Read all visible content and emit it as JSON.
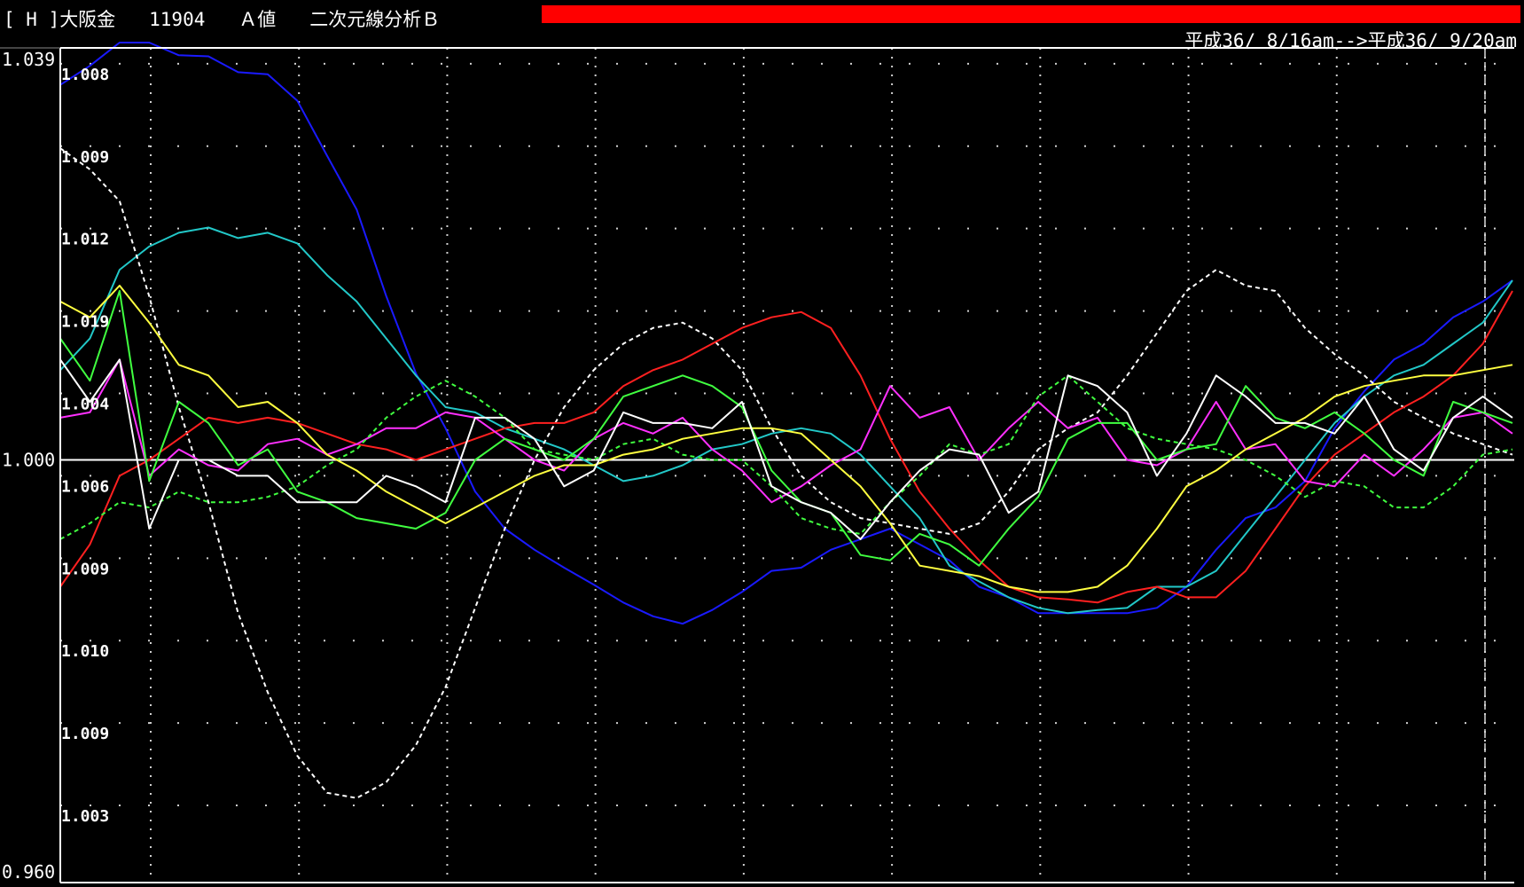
{
  "header": {
    "title": "[ H ]大阪金   11904   Ａ値   二次元線分析Ｂ",
    "range": "平成36/ 8/16am-->平成36/ 9/20am"
  },
  "colors": {
    "background": "#000000",
    "frame": "#ffffff",
    "grid": "#cfcfcf",
    "bar": "#ff0000"
  },
  "chart_data": {
    "type": "line",
    "x": [
      1,
      2,
      3,
      4,
      5,
      6,
      7,
      8,
      9,
      10,
      11,
      12,
      13,
      14,
      15,
      16,
      17,
      18,
      19,
      20,
      21,
      22,
      23,
      24,
      25,
      26,
      27,
      28,
      29,
      30,
      31,
      32,
      33,
      34,
      35,
      36,
      37,
      38,
      39,
      40,
      41,
      42,
      43,
      44,
      45,
      46,
      47,
      48,
      49,
      50
    ],
    "ylim": [
      0.96,
      1.039
    ],
    "y_axis_labels": [
      "1.039",
      "1.000",
      "0.960"
    ],
    "y_axis_label_values": [
      1.039,
      1.0,
      0.96
    ],
    "inner_labels": [
      "1.008",
      "1.009",
      "1.012",
      "1.019",
      "1.004",
      "1.006",
      "1.009",
      "1.010",
      "1.009",
      "1.003"
    ],
    "inner_label_values": [
      1.0375,
      1.0297,
      1.0219,
      1.0141,
      1.0063,
      0.9985,
      0.9907,
      0.9829,
      0.9751,
      0.9673
    ],
    "reference_line": 1.0,
    "series": [
      {
        "color": "#1a1aff",
        "dashed": false,
        "values": [
          1.0355,
          1.0373,
          1.0395,
          1.0395,
          1.0383,
          1.0382,
          1.0367,
          1.0365,
          1.034,
          1.0288,
          1.0237,
          1.0155,
          1.0082,
          1.003,
          0.997,
          0.9935,
          0.9915,
          0.9898,
          0.9882,
          0.9865,
          0.9852,
          0.9845,
          0.9858,
          0.9875,
          0.9895,
          0.9898,
          0.9915,
          0.9925,
          0.9935,
          0.992,
          0.9905,
          0.988,
          0.987,
          0.9855,
          0.9855,
          0.9855,
          0.9855,
          0.986,
          0.988,
          0.9915,
          0.9945,
          0.9955,
          0.998,
          1.003,
          1.0065,
          1.0095,
          1.011,
          1.0135,
          1.015,
          1.017
        ]
      },
      {
        "color": "#22c8c8",
        "dashed": false,
        "values": [
          1.0085,
          1.0115,
          1.018,
          1.0202,
          1.0215,
          1.022,
          1.021,
          1.0215,
          1.0205,
          1.0175,
          1.015,
          1.0115,
          1.008,
          1.005,
          1.0045,
          1.003,
          1.002,
          1.001,
          0.9995,
          0.998,
          0.9985,
          0.9995,
          1.001,
          1.0015,
          1.0025,
          1.003,
          1.0025,
          1.0005,
          0.9975,
          0.9945,
          0.99,
          0.9885,
          0.987,
          0.986,
          0.9855,
          0.9858,
          0.986,
          0.988,
          0.988,
          0.9895,
          0.993,
          0.9965,
          1.0,
          1.0035,
          1.006,
          1.008,
          1.009,
          1.011,
          1.013,
          1.017
        ]
      },
      {
        "color": "#ffffff",
        "dashed": true,
        "values": [
          1.0295,
          1.0275,
          1.0245,
          1.0155,
          1.005,
          0.996,
          0.9855,
          0.978,
          0.972,
          0.9685,
          0.968,
          0.9695,
          0.973,
          0.9785,
          0.986,
          0.9935,
          1.0,
          1.005,
          1.0085,
          1.011,
          1.0125,
          1.013,
          1.0115,
          1.0085,
          1.003,
          0.9985,
          0.996,
          0.9945,
          0.994,
          0.9935,
          0.993,
          0.994,
          0.997,
          1.001,
          1.003,
          1.0045,
          1.008,
          1.012,
          1.016,
          1.018,
          1.0165,
          1.016,
          1.0125,
          1.01,
          1.008,
          1.0055,
          1.004,
          1.0025,
          1.0015,
          1.0005
        ]
      },
      {
        "color": "#ff2020",
        "dashed": false,
        "values": [
          0.988,
          0.992,
          0.9985,
          1.0,
          1.002,
          1.004,
          1.0035,
          1.004,
          1.0035,
          1.0025,
          1.0015,
          1.001,
          1.0,
          1.001,
          1.002,
          1.003,
          1.0035,
          1.0035,
          1.0045,
          1.007,
          1.0085,
          1.0095,
          1.011,
          1.0125,
          1.0135,
          1.014,
          1.0125,
          1.008,
          1.002,
          0.997,
          0.9935,
          0.9905,
          0.988,
          0.987,
          0.9868,
          0.9865,
          0.9875,
          0.988,
          0.987,
          0.987,
          0.9895,
          0.9935,
          0.9975,
          1.0005,
          1.0025,
          1.0045,
          1.006,
          1.008,
          1.011,
          1.016
        ]
      },
      {
        "color": "#ff30ff",
        "dashed": false,
        "values": [
          1.004,
          1.0045,
          1.0095,
          0.9985,
          1.001,
          0.9995,
          0.999,
          1.0015,
          1.002,
          1.0005,
          1.0015,
          1.003,
          1.003,
          1.0045,
          1.004,
          1.002,
          1.0,
          0.999,
          1.002,
          1.0035,
          1.0025,
          1.004,
          1.001,
          0.999,
          0.996,
          0.9975,
          0.9995,
          1.001,
          1.007,
          1.004,
          1.005,
          1.0,
          1.003,
          1.0055,
          1.003,
          1.004,
          1.0,
          0.9995,
          1.001,
          1.0055,
          1.001,
          1.0015,
          0.998,
          0.9975,
          1.0005,
          0.9985,
          1.001,
          1.004,
          1.0045,
          1.0025
        ]
      },
      {
        "color": "#40ff40",
        "dashed": false,
        "values": [
          1.0115,
          1.0075,
          1.016,
          0.998,
          1.0055,
          1.0035,
          0.9995,
          1.001,
          0.997,
          0.996,
          0.9945,
          0.994,
          0.9935,
          0.995,
          1.0,
          1.002,
          1.001,
          1.0,
          1.002,
          1.006,
          1.007,
          1.008,
          1.007,
          1.005,
          0.999,
          0.996,
          0.995,
          0.991,
          0.9905,
          0.993,
          0.992,
          0.99,
          0.9935,
          0.9965,
          1.002,
          1.0035,
          1.0035,
          1.0,
          1.001,
          1.0015,
          1.007,
          1.004,
          1.003,
          1.0045,
          1.0025,
          1.0,
          0.9985,
          1.0055,
          1.0045,
          1.0035
        ]
      },
      {
        "color": "#40ff40",
        "dashed": true,
        "values": [
          0.9925,
          0.994,
          0.996,
          0.9955,
          0.997,
          0.996,
          0.996,
          0.9965,
          0.9975,
          0.9995,
          1.001,
          1.004,
          1.006,
          1.0075,
          1.006,
          1.004,
          1.001,
          1.0005,
          1.0,
          1.0015,
          1.002,
          1.0005,
          1.0,
          1.0,
          0.9975,
          0.9945,
          0.9935,
          0.993,
          0.996,
          0.9985,
          1.0015,
          1.0005,
          1.0015,
          1.006,
          1.008,
          1.0055,
          1.003,
          1.002,
          1.0015,
          1.001,
          1.0,
          0.9985,
          0.9965,
          0.998,
          0.9975,
          0.9955,
          0.9955,
          0.9975,
          1.0005,
          1.001
        ]
      },
      {
        "color": "#ffff40",
        "dashed": false,
        "values": [
          1.015,
          1.0135,
          1.0165,
          1.013,
          1.009,
          1.008,
          1.005,
          1.0055,
          1.0035,
          1.0005,
          0.999,
          0.997,
          0.9955,
          0.994,
          0.9955,
          0.997,
          0.9985,
          0.9995,
          0.9995,
          1.0005,
          1.001,
          1.002,
          1.0025,
          1.003,
          1.003,
          1.0025,
          1.0,
          0.9975,
          0.994,
          0.99,
          0.9895,
          0.989,
          0.988,
          0.9875,
          0.9875,
          0.988,
          0.99,
          0.9935,
          0.9975,
          0.999,
          1.001,
          1.0025,
          1.004,
          1.006,
          1.007,
          1.0075,
          1.008,
          1.008,
          1.0085,
          1.009
        ]
      },
      {
        "color": "#ffffff",
        "dashed": false,
        "values": [
          1.0095,
          1.0055,
          1.0095,
          0.9935,
          1.0,
          1.0,
          0.9985,
          0.9985,
          0.996,
          0.996,
          0.996,
          0.9985,
          0.9975,
          0.996,
          1.004,
          1.004,
          1.002,
          0.9975,
          0.999,
          1.0045,
          1.0035,
          1.0035,
          1.003,
          1.0055,
          0.9975,
          0.996,
          0.995,
          0.9925,
          0.996,
          0.999,
          1.001,
          1.0005,
          0.995,
          0.997,
          1.008,
          1.007,
          1.0045,
          0.9985,
          1.0025,
          1.008,
          1.006,
          1.0035,
          1.0035,
          1.0025,
          1.006,
          1.001,
          0.999,
          1.004,
          1.006,
          1.004
        ]
      }
    ]
  }
}
